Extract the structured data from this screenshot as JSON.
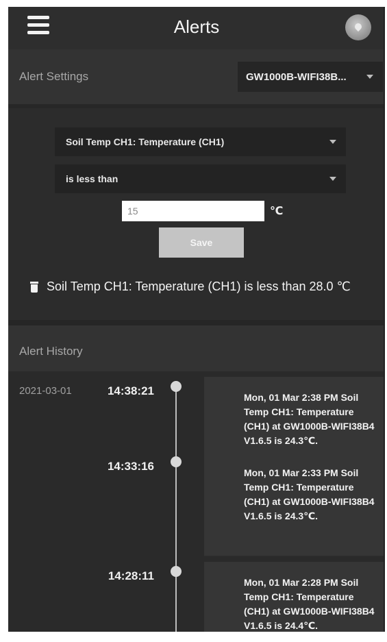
{
  "header": {
    "title": "Alerts",
    "menu_icon": "hamburger-icon",
    "avatar_icon": "user-avatar-icon"
  },
  "alert_settings": {
    "label": "Alert Settings",
    "device_select": "GW1000B-WIFI38B..."
  },
  "form": {
    "sensor_select": "Soil Temp CH1: Temperature (CH1)",
    "condition_select": "is less than",
    "value": "15",
    "unit": "℃",
    "save_label": "Save"
  },
  "existing_rule": {
    "text": "Soil Temp CH1: Temperature (CH1) is less than 28.0 ℃"
  },
  "history": {
    "label": "Alert History",
    "entries": [
      {
        "date": "2021-03-01",
        "time": "14:38:21",
        "message": "Mon, 01 Mar 2:38 PM Soil Temp CH1: Temperature (CH1) at GW1000B-WIFI38B4 V1.6.5 is 24.3℃."
      },
      {
        "date": "",
        "time": "14:33:16",
        "message": "Mon, 01 Mar 2:33 PM Soil Temp CH1: Temperature (CH1) at GW1000B-WIFI38B4 V1.6.5 is 24.3℃."
      },
      {
        "date": "",
        "time": "14:28:11",
        "message": "Mon, 01 Mar 2:28 PM Soil Temp CH1: Temperature (CH1) at GW1000B-WIFI38B4 V1.6.5 is 24.4℃."
      }
    ]
  },
  "colors": {
    "background": "#2b2b2b",
    "header": "#2e2e2e",
    "panel": "#333333",
    "select": "#232323",
    "save_button": "#c4c4c4",
    "text": "#f4f4f4",
    "muted_text": "#a8a8a8"
  }
}
